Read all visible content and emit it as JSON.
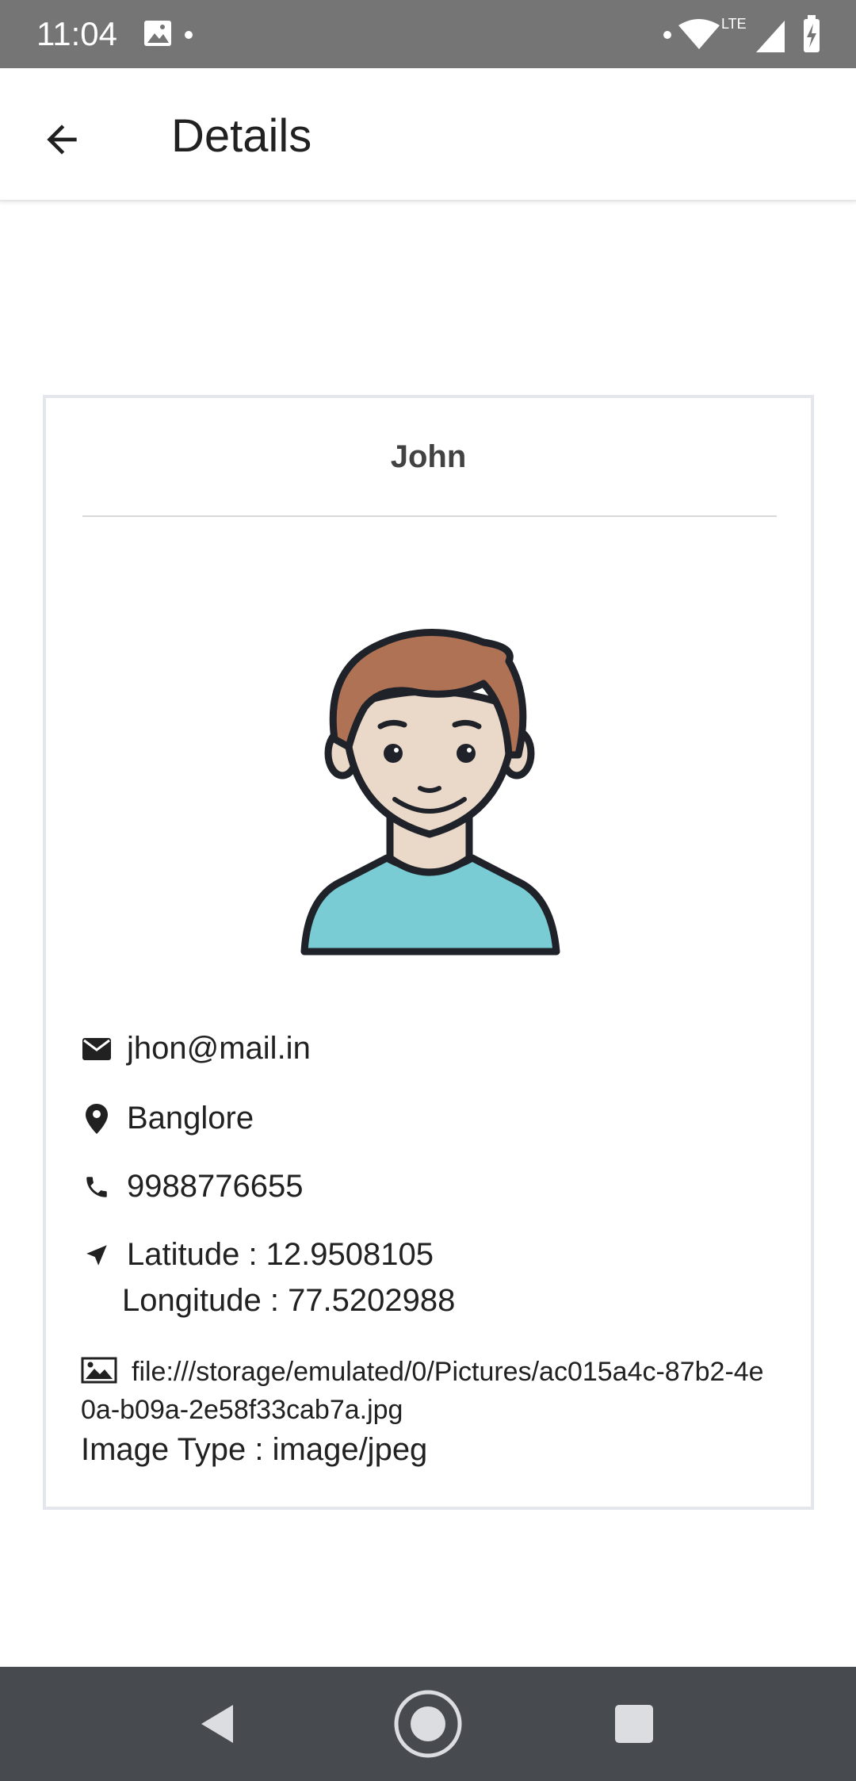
{
  "status_bar": {
    "time": "11:04",
    "network_label": "LTE",
    "icons": [
      "image-icon",
      "dot-icon",
      "wifi-icon",
      "signal-icon",
      "battery-charging-icon"
    ]
  },
  "app_bar": {
    "title": "Details",
    "back_icon": "arrow-left-icon"
  },
  "card": {
    "name": "John",
    "avatar_icon": "male-avatar-illustration",
    "email": "jhon@mail.in",
    "location": "Banglore",
    "phone": "9988776655",
    "latitude": "Latitude : 12.9508105",
    "longitude": "Longitude : 77.5202988",
    "image_path": "file:///storage/emulated/0/Pictures/ac015a4c-87b2-4e0a-b09a-2e58f33cab7a.jpg",
    "image_type": "Image Type : image/jpeg"
  },
  "nav_bar": {
    "icons": [
      "nav-back-icon",
      "nav-home-icon",
      "nav-recents-icon"
    ]
  },
  "colors": {
    "status_bar": "#757575",
    "nav_bar": "#474b50",
    "card_border": "#e3e6ea",
    "avatar_hair": "#b07255",
    "avatar_skin": "#ead8c9",
    "avatar_shirt": "#79ccd4",
    "avatar_outline": "#1f2329"
  }
}
